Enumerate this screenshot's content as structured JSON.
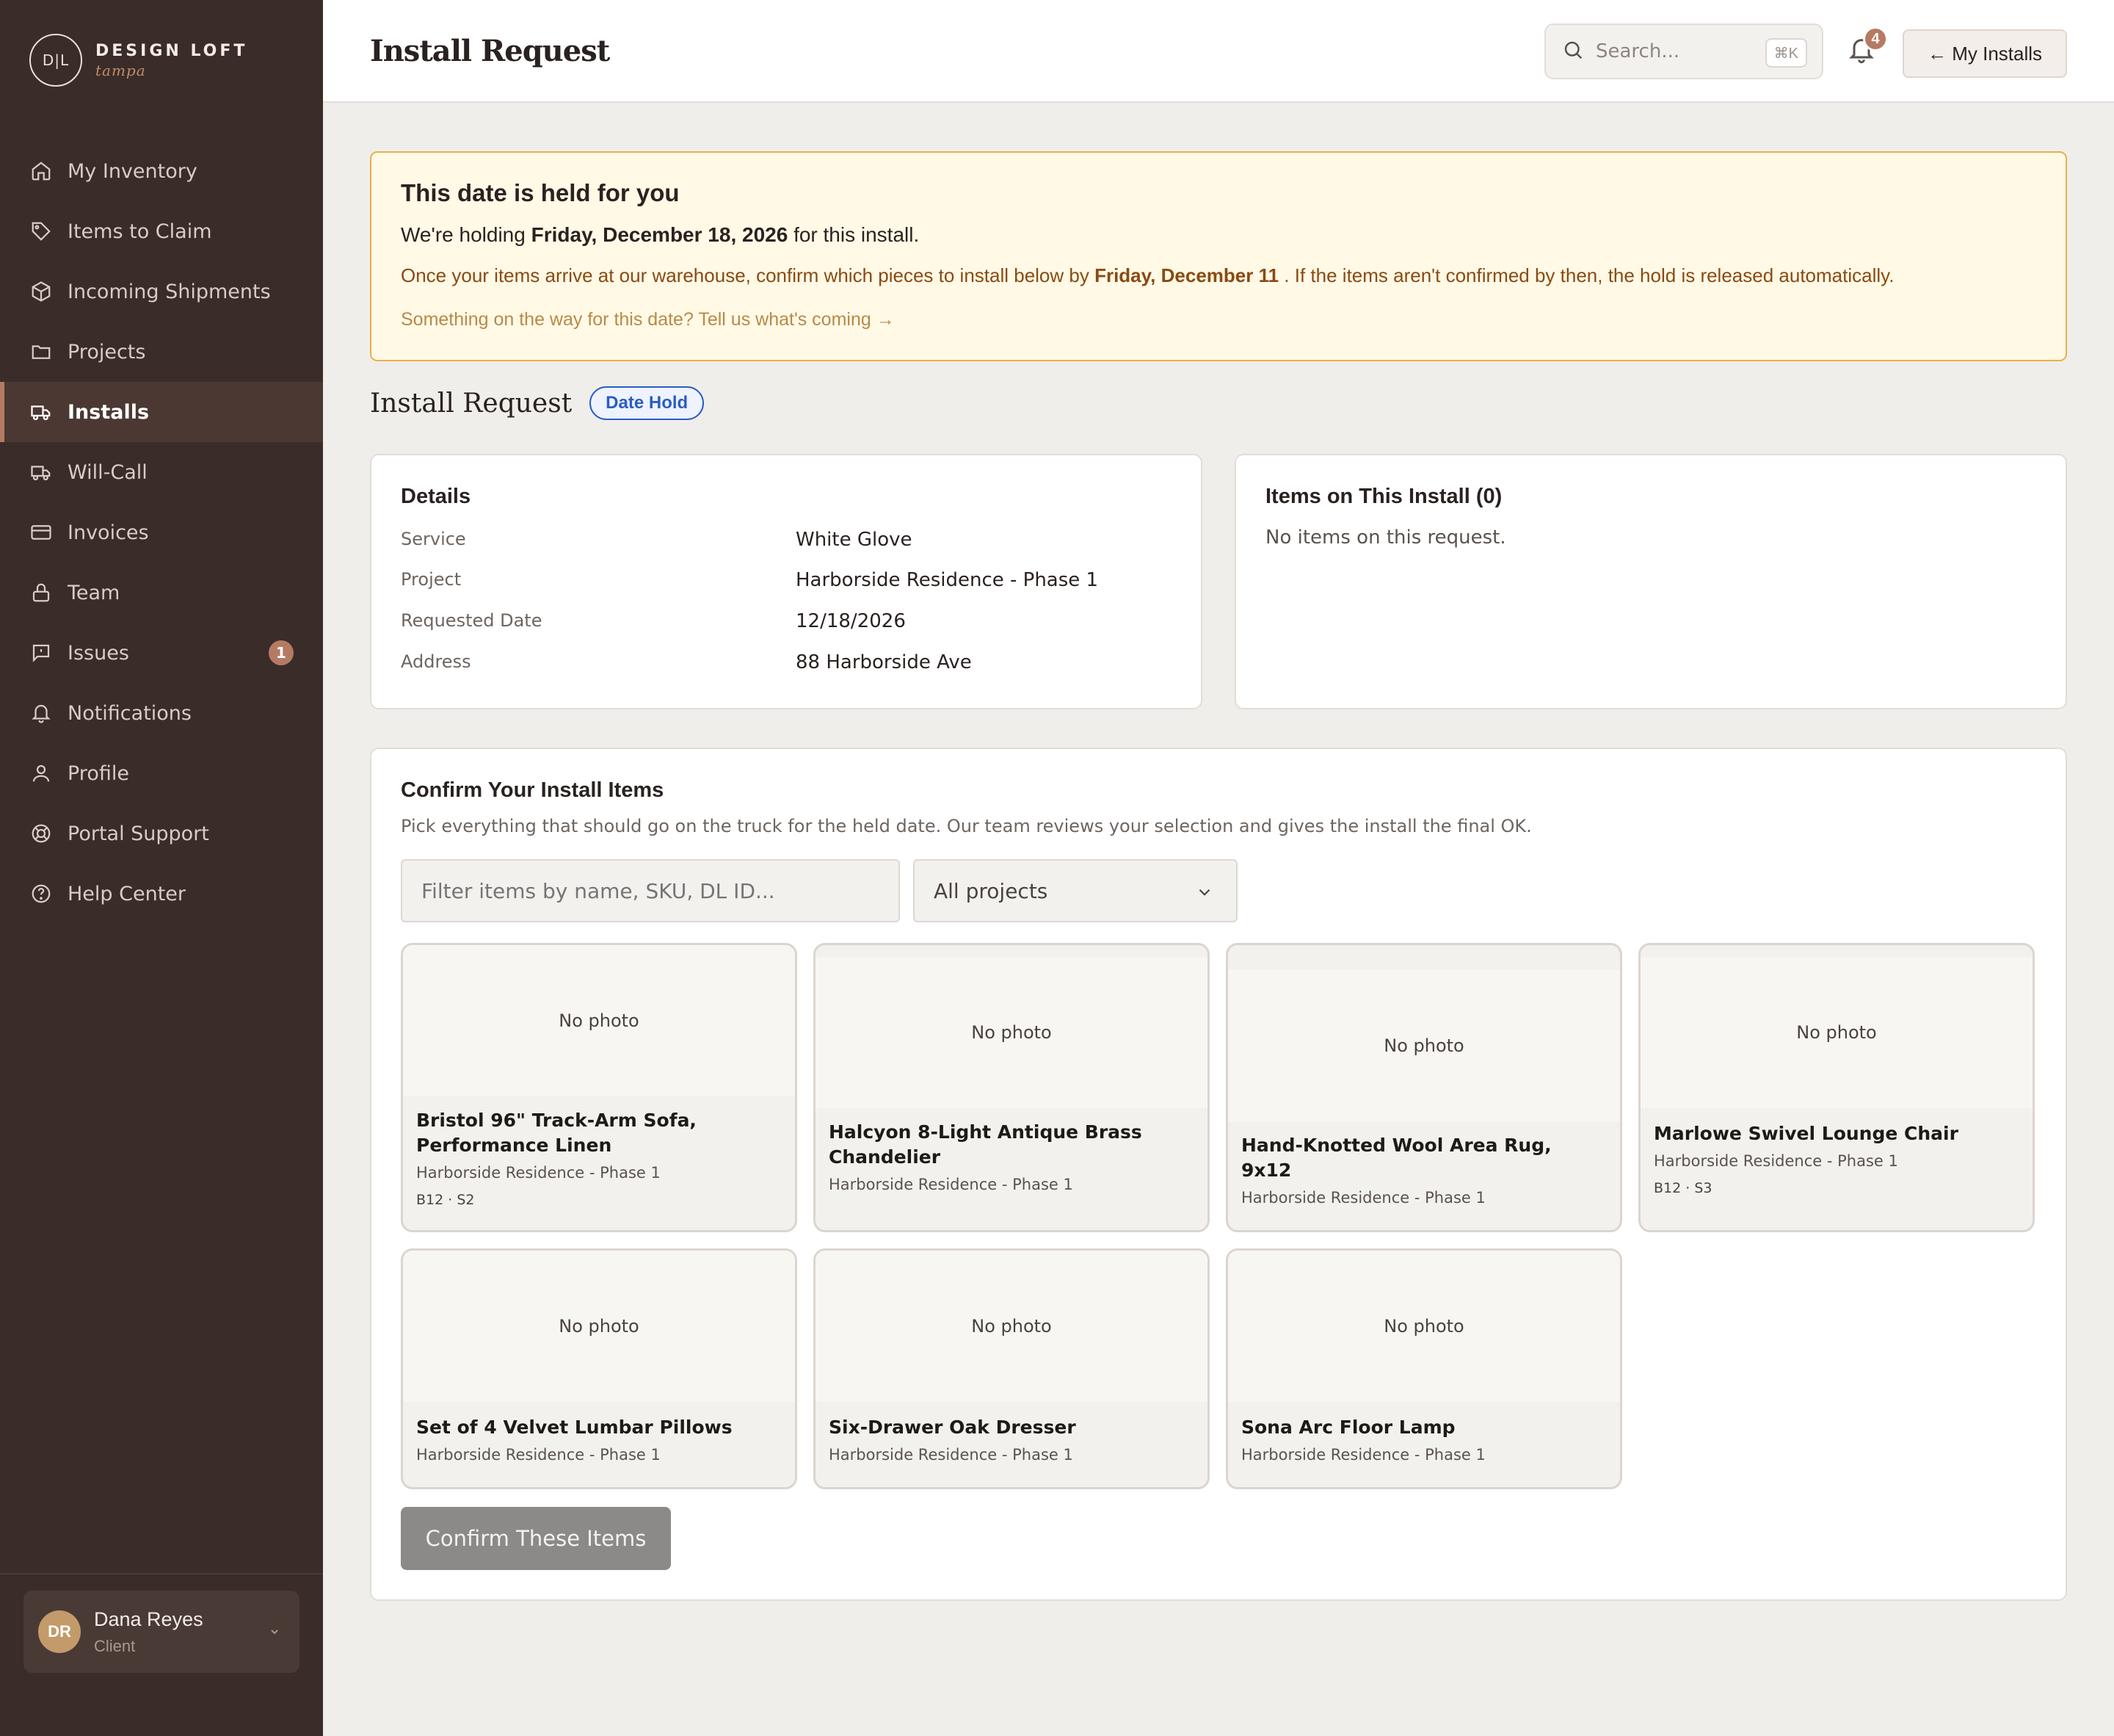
{
  "brand": {
    "mark": "D|L",
    "title": "DESIGN LOFT",
    "subtitle": "tampa"
  },
  "sidebar": {
    "items": [
      {
        "label": "My Inventory",
        "icon": "home-icon"
      },
      {
        "label": "Items to Claim",
        "icon": "tag-icon"
      },
      {
        "label": "Incoming Shipments",
        "icon": "box-icon"
      },
      {
        "label": "Projects",
        "icon": "folder-icon"
      },
      {
        "label": "Installs",
        "icon": "truck-icon",
        "active": true
      },
      {
        "label": "Will-Call",
        "icon": "truck-icon"
      },
      {
        "label": "Invoices",
        "icon": "card-icon"
      },
      {
        "label": "Team",
        "icon": "lock-icon"
      },
      {
        "label": "Issues",
        "icon": "message-icon",
        "badge": "1"
      },
      {
        "label": "Notifications",
        "icon": "bell-icon"
      },
      {
        "label": "Profile",
        "icon": "user-icon"
      },
      {
        "label": "Portal Support",
        "icon": "lifebuoy-icon"
      },
      {
        "label": "Help Center",
        "icon": "help-icon"
      }
    ],
    "user": {
      "initials": "DR",
      "name": "Dana Reyes",
      "role": "Client"
    }
  },
  "header": {
    "title": "Install Request",
    "search_placeholder": "Search...",
    "search_shortcut": "⌘K",
    "notification_count": "4",
    "back_label": "← My Installs"
  },
  "hold": {
    "title": "This date is held for you",
    "line1_prefix": "We're holding ",
    "line1_date": "Friday, December 18, 2026",
    "line1_suffix": " for this install.",
    "line2_prefix": "Once your items arrive at our warehouse, confirm which pieces to install below by ",
    "line2_date": "Friday, December 11",
    "line2_suffix": " . If the items aren't confirmed by then, the hold is released automatically.",
    "link": "Something on the way for this date? Tell us what's coming →"
  },
  "request": {
    "title": "Install Request",
    "status": "Date Hold"
  },
  "details": {
    "title": "Details",
    "rows": [
      {
        "label": "Service",
        "value": "White Glove"
      },
      {
        "label": "Project",
        "value": "Harborside Residence - Phase 1"
      },
      {
        "label": "Requested Date",
        "value": "12/18/2026"
      },
      {
        "label": "Address",
        "value": "88 Harborside Ave"
      }
    ]
  },
  "items_on_install": {
    "title": "Items on This Install (0)",
    "empty": "No items on this request."
  },
  "confirm": {
    "title": "Confirm Your Install Items",
    "subtitle": "Pick everything that should go on the truck for the held date. Our team reviews your selection and gives the install the final OK.",
    "filter_placeholder": "Filter items by name, SKU, DL ID...",
    "project_select": "All projects",
    "button_label": "Confirm These Items",
    "items": [
      {
        "photo": "No photo",
        "name": "Bristol 96\" Track-Arm Sofa, Performance Linen",
        "project": "Harborside Residence - Phase 1",
        "location": "B12 · S2"
      },
      {
        "photo": "No photo",
        "name": "Halcyon 8-Light Antique Brass Chandelier",
        "project": "Harborside Residence - Phase 1",
        "location": ""
      },
      {
        "photo": "No photo",
        "name": "Hand-Knotted Wool Area Rug, 9x12",
        "project": "Harborside Residence - Phase 1",
        "location": ""
      },
      {
        "photo": "No photo",
        "name": "Marlowe Swivel Lounge Chair",
        "project": "Harborside Residence - Phase 1",
        "location": "B12 · S3"
      },
      {
        "photo": "No photo",
        "name": "Set of 4 Velvet Lumbar Pillows",
        "project": "Harborside Residence - Phase 1",
        "location": ""
      },
      {
        "photo": "No photo",
        "name": "Six-Drawer Oak Dresser",
        "project": "Harborside Residence - Phase 1",
        "location": ""
      },
      {
        "photo": "No photo",
        "name": "Sona Arc Floor Lamp",
        "project": "Harborside Residence - Phase 1",
        "location": ""
      }
    ]
  }
}
